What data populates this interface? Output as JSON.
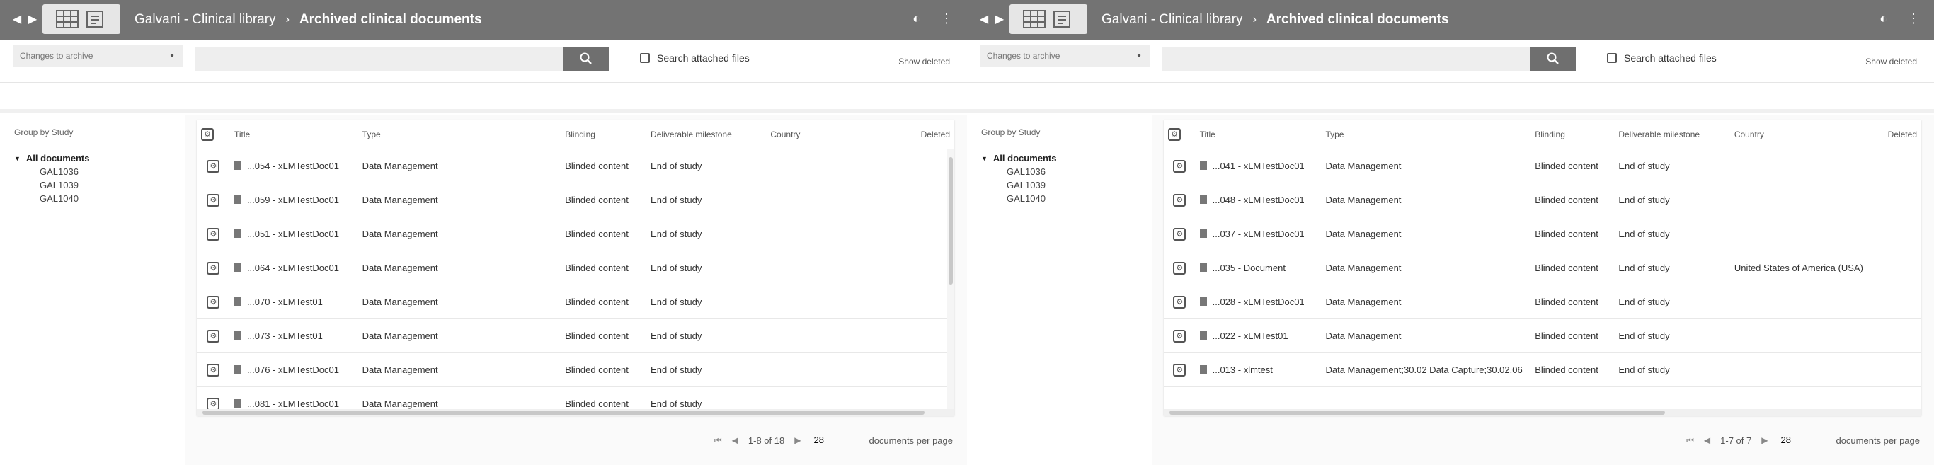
{
  "panes": [
    {
      "header": {
        "back_icon": "arrow-left-icon",
        "forward_icon": "arrow-right-icon",
        "breadcrumb_root": "Galvani - Clinical library",
        "breadcrumb_sep": "›",
        "breadcrumb_current": "Archived clinical documents",
        "right_icons": [
          "circle-help-icon",
          "more-vert-icon"
        ]
      },
      "toolbar": {
        "changes_label": "Changes to archive",
        "search_placeholder": "",
        "search_attached_label": "Search attached files",
        "show_deleted_label": "Show deleted"
      },
      "sidebar": {
        "group_by_label": "Group by Study",
        "root_label": "All documents",
        "nodes": [
          "GAL1036",
          "GAL1039",
          "GAL1040"
        ]
      },
      "grid": {
        "headers": [
          "",
          "Title",
          "Type",
          "Blinding",
          "Deliverable milestone",
          "Country",
          "Deleted"
        ],
        "rows": [
          [
            "",
            "...054 - xLMTestDoc01",
            "Data Management",
            "Blinded content",
            "End of study",
            "",
            ""
          ],
          [
            "",
            "...059 - xLMTestDoc01",
            "Data Management",
            "Blinded content",
            "End of study",
            "",
            ""
          ],
          [
            "",
            "...051 - xLMTestDoc01",
            "Data Management",
            "Blinded content",
            "End of study",
            "",
            ""
          ],
          [
            "",
            "...064 - xLMTestDoc01",
            "Data Management",
            "Blinded content",
            "End of study",
            "",
            ""
          ],
          [
            "",
            "...070 - xLMTest01",
            "Data Management",
            "Blinded content",
            "End of study",
            "",
            ""
          ],
          [
            "",
            "...073 - xLMTest01",
            "Data Management",
            "Blinded content",
            "End of study",
            "",
            ""
          ],
          [
            "",
            "...076 - xLMTestDoc01",
            "Data Management",
            "Blinded content",
            "End of study",
            "",
            ""
          ],
          [
            "",
            "...081 - xLMTestDoc01",
            "Data Management",
            "Blinded content",
            "End of study",
            "",
            ""
          ]
        ]
      },
      "pager": {
        "range": "1-8 of 18",
        "per_page": "28",
        "per_page_label": "documents per page"
      }
    },
    {
      "header": {
        "back_icon": "arrow-left-icon",
        "forward_icon": "arrow-right-icon",
        "breadcrumb_root": "Galvani - Clinical library",
        "breadcrumb_sep": "›",
        "breadcrumb_current": "Archived clinical documents",
        "right_icons": [
          "circle-help-icon",
          "more-vert-icon"
        ]
      },
      "toolbar": {
        "changes_label": "Changes to archive",
        "search_placeholder": "",
        "search_attached_label": "Search attached files",
        "show_deleted_label": "Show deleted"
      },
      "sidebar": {
        "group_by_label": "Group by Study",
        "root_label": "All documents",
        "nodes": [
          "GAL1036",
          "GAL1039",
          "GAL1040"
        ]
      },
      "grid": {
        "headers": [
          "",
          "Title",
          "Type",
          "Blinding",
          "Deliverable milestone",
          "Country",
          "Deleted"
        ],
        "rows": [
          [
            "",
            "...041 - xLMTestDoc01",
            "Data Management",
            "Blinded content",
            "End of study",
            "",
            ""
          ],
          [
            "",
            "...048 - xLMTestDoc01",
            "Data Management",
            "Blinded content",
            "End of study",
            "",
            ""
          ],
          [
            "",
            "...037 - xLMTestDoc01",
            "Data Management",
            "Blinded content",
            "End of study",
            "",
            ""
          ],
          [
            "",
            "...035 - Document",
            "Data Management",
            "Blinded content",
            "End of study",
            "United States of America (USA)",
            ""
          ],
          [
            "",
            "...028 - xLMTestDoc01",
            "Data Management",
            "Blinded content",
            "End of study",
            "",
            ""
          ],
          [
            "",
            "...022 - xLMTest01",
            "Data Management",
            "Blinded content",
            "End of study",
            "",
            ""
          ],
          [
            "",
            "...013 - xlmtest",
            "Data Management;30.02 Data Capture;30.02.06",
            "Blinded content",
            "End of study",
            "",
            ""
          ]
        ]
      },
      "pager": {
        "range": "1-7 of 7",
        "per_page": "28",
        "per_page_label": "documents per page"
      }
    }
  ]
}
